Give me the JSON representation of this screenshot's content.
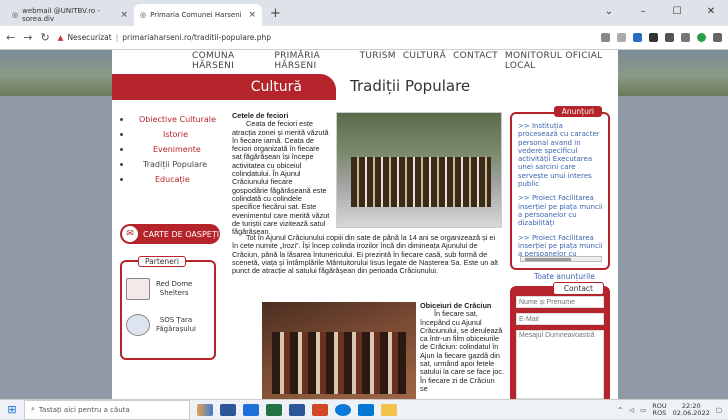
{
  "browser": {
    "tabs": [
      {
        "title": "webmail @UNITBV.ro - sorea.div"
      },
      {
        "title": "Primaria Comunei Harseni"
      }
    ],
    "new_tab": "+",
    "minimize": "–",
    "maximize": "☐",
    "close": "✕",
    "security": "Nesecurizat",
    "url": "primariaharseni.ro/traditii-populare.php"
  },
  "site": {
    "nav": [
      "COMUNA HĂRSENI",
      "PRIMĂRIA HĂRSENI",
      "TURISM",
      "CULTURĂ",
      "CONTACT",
      "MONITORUL OFICIAL LOCAL"
    ],
    "section": "Cultură",
    "page_title": "Tradiții Populare",
    "menu": [
      "Obiective Culturale",
      "Istorie",
      "Evenimente",
      "Tradiții Populare",
      "Educație"
    ],
    "guestbook": "CARTE DE OASPEȚI",
    "partners_title": "Parteneri",
    "partners": [
      {
        "line1": "Red Dome",
        "line2": "Shelters"
      },
      {
        "line1": "SOS Țara",
        "line2": "Făgărașului"
      }
    ]
  },
  "article": {
    "h1": "Cetele de feciori",
    "p1": "Ceata de feciori este atracția zonei și merită văzută în fiecare iarnă. Ceata de feciori organizată în fiecare sat făgărășean își începe activitatea cu obiceiul colindatului. În Ajunul Crăciunului fiecare gospodărie făgărășeană este colindată cu colindele specifice fiecărui sat. Este evenimentul care merită văzut de turiștii care vizitează satul făgărășean.",
    "p2": "Tot în Ajunul Crăciunului copiii din sate de până la 14 ani se organizează și ei în cete numite „Irozi”. Își încep colinda irozilor încă din dimineața Ajunului de Crăciun, până la lăsarea întunericului. Ei prezintă în fiecare casă, sub formă de scenetă, viața și întâmplările Mântuitorului Iisus legate de Nașterea Sa. Este un alt punct de atracție al satului făgărășean din perioada Crăciunului.",
    "h2": "Obiceiuri de Crăciun",
    "p3": "În fiecare sat, începând cu Ajunul Crăciunului, se derulează ca într-un film obiceiurile de Crăciun: colindatul în Ajun la fiecare gazdă din sat, urmând apoi fetele satului la care se face joc. În fiecare zi de Crăciun se"
  },
  "announcements": {
    "title": "Anunțuri",
    "items": [
      ">> Instituția procesează cu caracter personal avand in vedere specificul activității Executarea unei sarcini care servește unui interes public",
      ">> Proiect Facilitarea inserției pe piața muncii a persoanelor cu dizabilități",
      ">> Proiect Facilitarea inserției pe piața muncii a persoanelor cu dizabilități"
    ],
    "all_link": "Toate anunțurile"
  },
  "contact": {
    "title": "Contact",
    "name_placeholder": "Nume și Prenume",
    "email_placeholder": "E-Mail",
    "message_placeholder": "Mesajul Dumneavoastră"
  },
  "taskbar": {
    "search_placeholder": "Tastați aici pentru a căuta",
    "lang": "ROU",
    "lang2": "ROS",
    "time": "22:20",
    "date": "02.06.2022"
  },
  "colors": {
    "accent": "#b4242a",
    "link": "#3b64b0"
  }
}
